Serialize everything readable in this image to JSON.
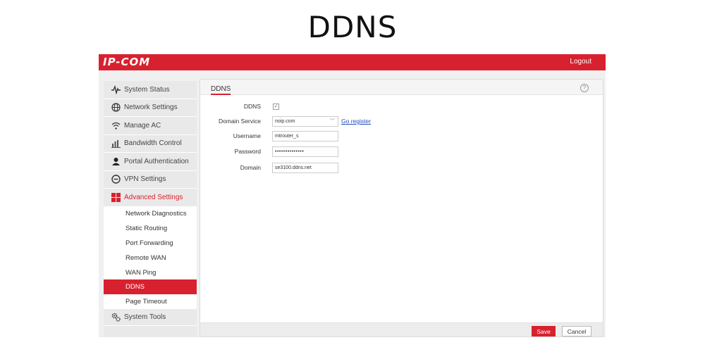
{
  "page": {
    "heading": "DDNS"
  },
  "header": {
    "logo": "IP-COM",
    "logout_label": "Logout"
  },
  "sidebar": {
    "items": [
      {
        "label": "System Status",
        "icon": "pulse-icon"
      },
      {
        "label": "Network Settings",
        "icon": "globe-icon"
      },
      {
        "label": "Manage AC",
        "icon": "wifi-icon"
      },
      {
        "label": "Bandwidth Control",
        "icon": "bar-chart-icon"
      },
      {
        "label": "Portal Authentication",
        "icon": "user-icon"
      },
      {
        "label": "VPN Settings",
        "icon": "vpn-icon"
      },
      {
        "label": "Advanced Settings",
        "icon": "grid-icon"
      }
    ],
    "subitems": [
      "Network Diagnostics",
      "Static Routing",
      "Port Forwarding",
      "Remote WAN",
      "WAN Ping",
      "DDNS",
      "Page Timeout"
    ],
    "last_item": {
      "label": "System Tools",
      "icon": "gears-icon"
    }
  },
  "main": {
    "tab_title": "DDNS",
    "help": "?",
    "form": {
      "ddns_label": "DDNS",
      "ddns_checked": true,
      "service_label": "Domain Service",
      "service_value": "noip.com",
      "register_link": "Go register",
      "username_label": "Username",
      "username_value": "mtrouter_s",
      "password_label": "Password",
      "password_value": "••••••••••••••",
      "domain_label": "Domain",
      "domain_value": "se3100.ddns.net"
    },
    "buttons": {
      "save": "Save",
      "cancel": "Cancel"
    }
  },
  "colors": {
    "brand_red": "#d8212e",
    "link_blue": "#1a4fbf"
  }
}
